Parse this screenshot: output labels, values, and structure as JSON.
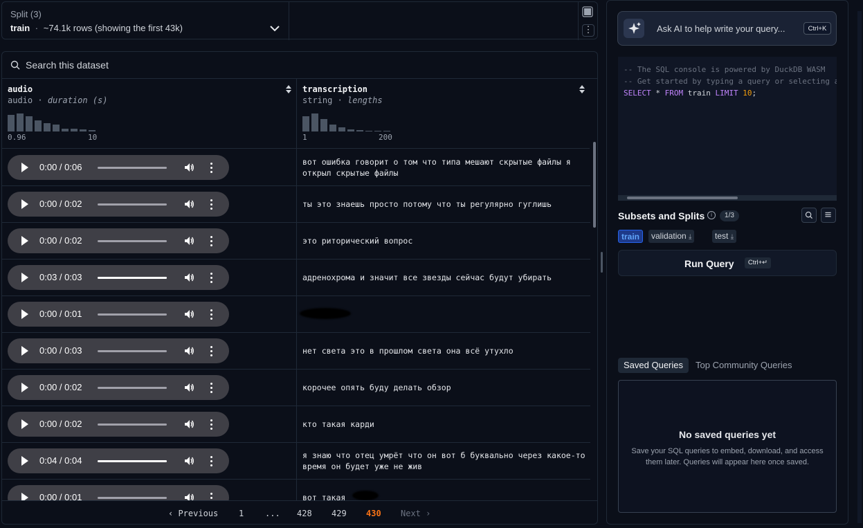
{
  "split": {
    "label": "Split (3)",
    "name": "train",
    "separator": "·",
    "rows_info": "~74.1k rows (showing the first 43k)"
  },
  "search": {
    "placeholder": "Search this dataset"
  },
  "columns": [
    {
      "name": "audio",
      "type": "audio",
      "stat": "duration (s)",
      "hist_min": "0.96",
      "hist_max": "10",
      "hist_values": [
        24,
        26,
        22,
        16,
        12,
        10,
        4,
        4,
        3,
        2
      ]
    },
    {
      "name": "transcription",
      "type": "string",
      "stat": "lengths",
      "hist_min": "1",
      "hist_max": "200",
      "hist_values": [
        22,
        26,
        18,
        10,
        6,
        3,
        2,
        1,
        1,
        1
      ]
    }
  ],
  "rows": [
    {
      "time": "0:00 / 0:06",
      "progress": 0,
      "text": "вот ошибка говорит о том что типа мешают скрытые файлы я открыл скрытые файлы"
    },
    {
      "time": "0:00 / 0:02",
      "progress": 0,
      "text": "ты это знаешь просто потому что ты регулярно гуглишь"
    },
    {
      "time": "0:00 / 0:02",
      "progress": 0,
      "text": "это риторический вопрос"
    },
    {
      "time": "0:03 / 0:03",
      "progress": 1,
      "text": "адренохрома и значит все звезды сейчас будут убирать"
    },
    {
      "time": "0:00 / 0:01",
      "progress": 0,
      "text": ""
    },
    {
      "time": "0:00 / 0:03",
      "progress": 0,
      "text": "нет света это в прошлом света она всё утухло"
    },
    {
      "time": "0:00 / 0:02",
      "progress": 0,
      "text": "корочее опять буду делать обзор"
    },
    {
      "time": "0:00 / 0:02",
      "progress": 0,
      "text": "кто такая карди"
    },
    {
      "time": "0:04 / 0:04",
      "progress": 1,
      "text": "я знаю что отец умрёт что он вот б буквально через какое-то время он будет уже не жив"
    },
    {
      "time": "0:00 / 0:01",
      "progress": 0,
      "text": "вот такая"
    }
  ],
  "pagination": {
    "prev": "Previous",
    "next": "Next",
    "pages": [
      "1",
      "...",
      "428",
      "429",
      "430"
    ],
    "active": "430"
  },
  "ai": {
    "label": "Ask AI to help write your query...",
    "shortcut": "Ctrl+K"
  },
  "sql": {
    "comment1": "-- The SQL console is powered by DuckDB WASM",
    "comment2": "-- Get started by typing a query or selecting a view",
    "kw_select": "SELECT",
    "star": " * ",
    "kw_from": "FROM",
    "table": " train ",
    "kw_limit": "LIMIT",
    "limit": " 10",
    "semi": ";"
  },
  "subsets": {
    "title": "Subsets and Splits",
    "count": "1/3",
    "chips": [
      "train",
      "validation",
      "test"
    ]
  },
  "run": {
    "label": "Run Query",
    "shortcut": "Ctrl+↵"
  },
  "queries_tabs": {
    "saved": "Saved Queries",
    "community": "Top Community Queries"
  },
  "saved_empty": {
    "title": "No saved queries yet",
    "desc": "Save your SQL queries to embed, download, and access them later. Queries will appear here once saved."
  },
  "colors": {
    "accent": "#f97316",
    "train_chip": "#60a5fa",
    "keyword": "#c084fc",
    "number": "#f59e0b"
  }
}
